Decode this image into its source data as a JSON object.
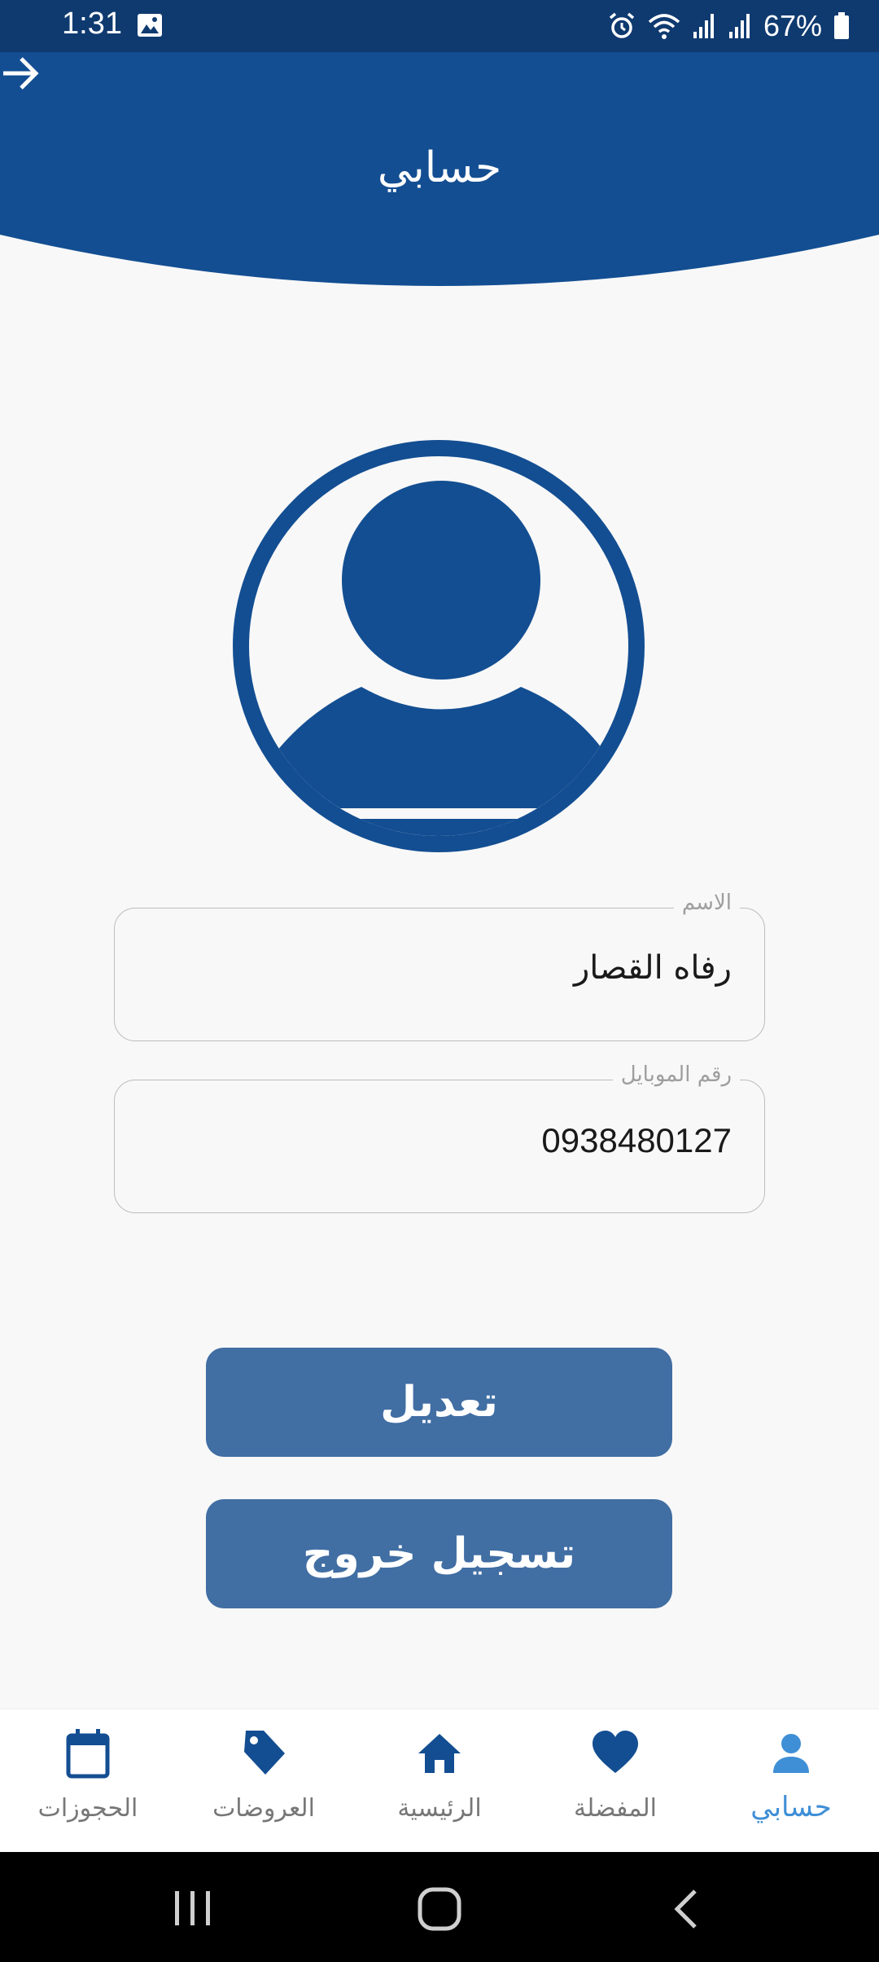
{
  "status_bar": {
    "time": "1:31",
    "battery_percent": "67%"
  },
  "header": {
    "title": "حسابي",
    "back_icon": "arrow-right-icon"
  },
  "avatar": {
    "icon": "user-avatar-icon",
    "color": "#134e92"
  },
  "form": {
    "name": {
      "label": "الاسم",
      "value": "رفاه القصار"
    },
    "mobile": {
      "label": "رقم الموبايل",
      "value": "0938480127"
    }
  },
  "buttons": {
    "edit_label": "تعديل",
    "logout_label": "تسجيل خروج"
  },
  "bottom_nav": {
    "items": [
      {
        "label": "الحجوزات",
        "icon": "calendar-icon",
        "active": false
      },
      {
        "label": "العروضات",
        "icon": "tag-icon",
        "active": false
      },
      {
        "label": "الرئيسية",
        "icon": "home-icon",
        "active": false
      },
      {
        "label": "المفضلة",
        "icon": "heart-icon",
        "active": false
      },
      {
        "label": "حسابي",
        "icon": "person-icon",
        "active": true
      }
    ]
  },
  "colors": {
    "primary": "#134e92",
    "status_bar": "#0f3a70",
    "button": "#416ea3",
    "active_nav": "#3f8fd6",
    "background": "#f8f8f8"
  }
}
